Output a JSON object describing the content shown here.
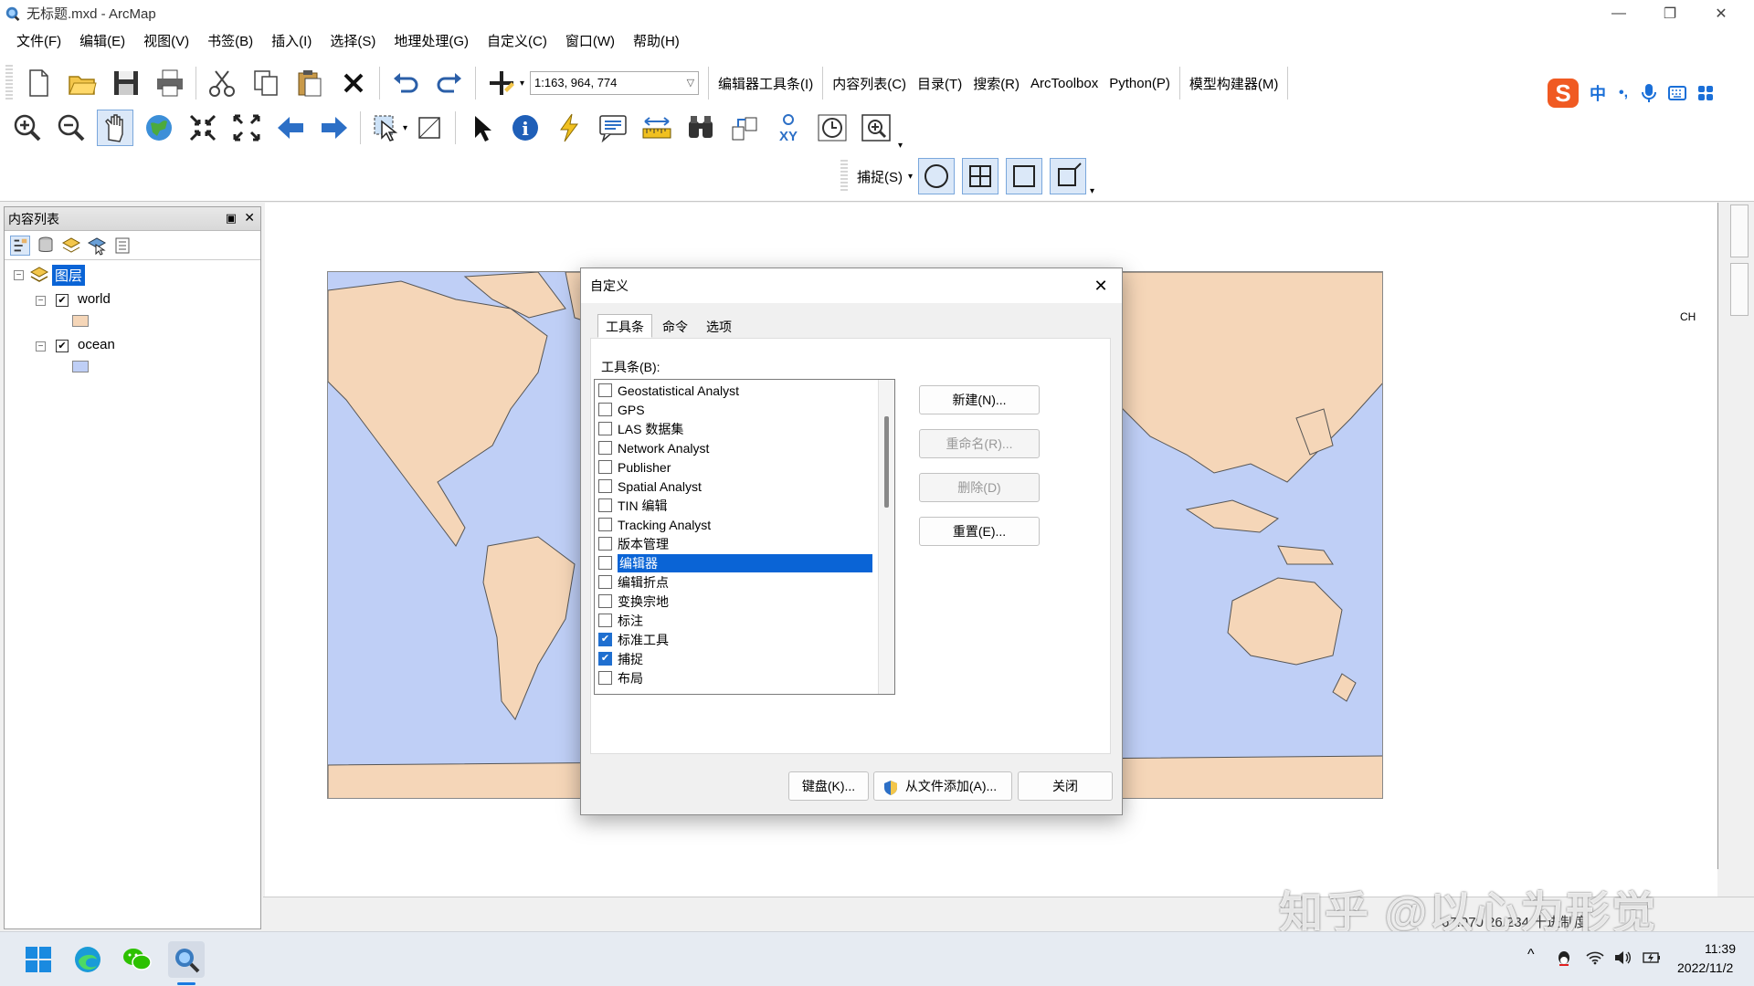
{
  "window": {
    "title": "无标题.mxd - ArcMap",
    "minimize_glyph": "—",
    "restore_glyph": "❐",
    "close_glyph": "✕"
  },
  "menu": [
    "文件(F)",
    "编辑(E)",
    "视图(V)",
    "书签(B)",
    "插入(I)",
    "选择(S)",
    "地理处理(G)",
    "自定义(C)",
    "窗口(W)",
    "帮助(H)"
  ],
  "toolbar": {
    "scale_value": "1:163, 964, 774",
    "links": [
      "编辑器工具条(I)",
      "内容列表(C)",
      "目录(T)",
      "搜索(R)",
      "ArcToolbox",
      "Python(P)",
      "模型构建器(M)"
    ],
    "snapping_label": "捕捉(S)",
    "ime_labels": [
      "中",
      "•,",
      "ᒧ"
    ],
    "icons_row1": [
      "new-document-icon",
      "open-folder-icon",
      "save-icon",
      "print-icon",
      "cut-icon",
      "copy-icon",
      "paste-icon",
      "delete-icon",
      "undo-icon",
      "redo-icon",
      "add-data-icon"
    ],
    "icons_row2": [
      "zoom-in-icon",
      "zoom-out-icon",
      "pan-icon",
      "full-extent-icon",
      "fixed-zoom-in-icon",
      "fixed-zoom-out-icon",
      "back-extent-icon",
      "forward-extent-icon",
      "select-features-icon",
      "clear-selection-icon",
      "select-elements-icon",
      "identify-icon",
      "hyperlink-icon",
      "html-popup-icon",
      "measure-icon",
      "find-icon",
      "find-route-icon",
      "go-to-xy-icon",
      "time-slider-icon",
      "viewer-window-icon"
    ]
  },
  "toc": {
    "title": "内容列表",
    "root_label": "图层",
    "layers": [
      {
        "name": "world",
        "checked": true,
        "swatch": "#f5d6b8"
      },
      {
        "name": "ocean",
        "checked": true,
        "swatch": "#bfcff6"
      }
    ]
  },
  "right_strip": {
    "ch_label": "CH"
  },
  "dialog": {
    "title": "自定义",
    "tabs": [
      "工具条",
      "命令",
      "选项"
    ],
    "list_label": "工具条(B):",
    "toolbars": [
      {
        "name": "Geostatistical Analyst",
        "checked": false
      },
      {
        "name": "GPS",
        "checked": false
      },
      {
        "name": "LAS 数据集",
        "checked": false
      },
      {
        "name": "Network Analyst",
        "checked": false
      },
      {
        "name": "Publisher",
        "checked": false
      },
      {
        "name": "Spatial Analyst",
        "checked": false
      },
      {
        "name": "TIN 编辑",
        "checked": false
      },
      {
        "name": "Tracking Analyst",
        "checked": false
      },
      {
        "name": "版本管理",
        "checked": false
      },
      {
        "name": "编辑器",
        "checked": false,
        "selected": true
      },
      {
        "name": "编辑折点",
        "checked": false
      },
      {
        "name": "变换宗地",
        "checked": false
      },
      {
        "name": "标注",
        "checked": false
      },
      {
        "name": "标准工具",
        "checked": true
      },
      {
        "name": "捕捉",
        "checked": true
      },
      {
        "name": "布局",
        "checked": false
      }
    ],
    "buttons": {
      "new": "新建(N)...",
      "rename": "重命名(R)...",
      "delete": "删除(D)",
      "reset": "重置(E)...",
      "keyboard": "键盘(K)...",
      "add_from_file": "从文件添加(A)...",
      "close": "关闭"
    }
  },
  "status": {
    "coords": "-67.970  26.234 十进制度"
  },
  "watermark": "知乎 @以心为形觉",
  "taskbar": {
    "time": "11:39",
    "date": "2022/11/2",
    "tray_caret": "^"
  },
  "colors": {
    "land": "#f5d6b8",
    "ocean": "#bfcff6",
    "selection": "#0a64d6",
    "accent": "#1f6fd0"
  }
}
